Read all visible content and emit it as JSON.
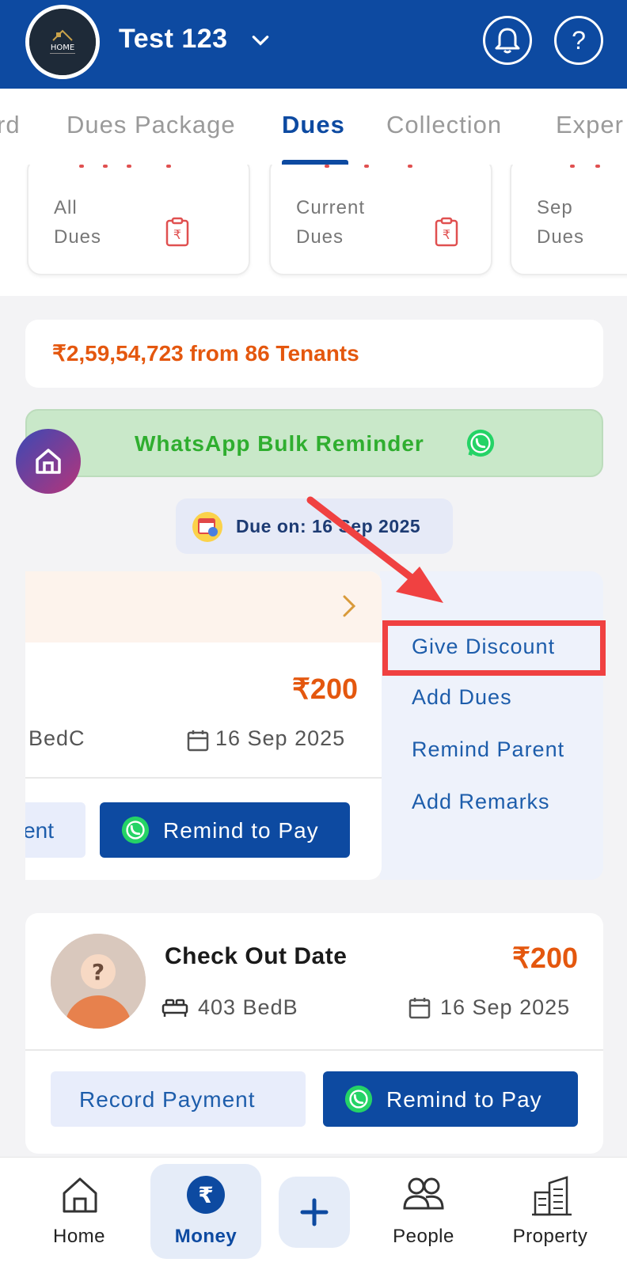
{
  "header": {
    "property_name": "Test 123",
    "logo_text": "HOME"
  },
  "tabs": [
    {
      "label": "rd"
    },
    {
      "label": "Dues Package"
    },
    {
      "label": "Dues"
    },
    {
      "label": "Collection"
    },
    {
      "label": "Exper"
    }
  ],
  "summary_cards": [
    {
      "label": "All\nDues"
    },
    {
      "label": "Current\nDues"
    },
    {
      "label": "Sep\nDues"
    }
  ],
  "total_summary": "₹2,59,54,723 from 86 Tenants",
  "whatsapp_bulk": {
    "label": "WhatsApp Bulk Reminder"
  },
  "due_on": "Due on: 16 Sep 2025",
  "first_entry": {
    "amount": "₹200",
    "bed": "BedC",
    "date": "16 Sep 2025",
    "record_label": "ent",
    "remind_label": "Remind to Pay"
  },
  "swipe_menu": {
    "items": [
      "Give Discount",
      "Add Dues",
      "Remind Parent",
      "Add Remarks"
    ]
  },
  "second_entry": {
    "name": "Check Out Date",
    "amount": "₹200",
    "bed": "403 BedB",
    "date": "16 Sep 2025",
    "record_label": "Record Payment",
    "remind_label": "Remind to Pay"
  },
  "bottom_nav": {
    "items": [
      {
        "label": "Home",
        "icon": "home-icon"
      },
      {
        "label": "Money",
        "icon": "rupee-icon"
      },
      {
        "label": "",
        "icon": "plus-icon"
      },
      {
        "label": "People",
        "icon": "people-icon"
      },
      {
        "label": "Property",
        "icon": "building-icon"
      }
    ]
  },
  "colors": {
    "primary": "#0d4aa1",
    "accent_orange": "#e4570e",
    "whatsapp_green": "#2fae2f",
    "highlight_red": "#f04141"
  }
}
